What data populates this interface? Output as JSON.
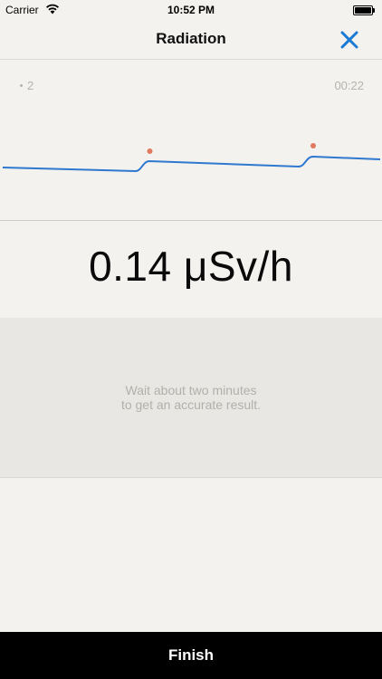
{
  "status_bar": {
    "carrier": "Carrier",
    "time": "10:52 PM",
    "wifi_icon": "wifi-icon",
    "battery_icon": "battery-icon"
  },
  "nav": {
    "title": "Radiation",
    "close_icon": "close-icon",
    "accent_color": "#1a7ad4"
  },
  "chart": {
    "measurement_count": "2",
    "elapsed": "00:22",
    "line_color": "#2f78cf",
    "marker_color": "#e07a5f"
  },
  "reading": {
    "value": "0.14 μSv/h"
  },
  "hint": {
    "line1": "Wait about two minutes",
    "line2": "to get an accurate result."
  },
  "footer": {
    "finish_label": "Finish"
  }
}
